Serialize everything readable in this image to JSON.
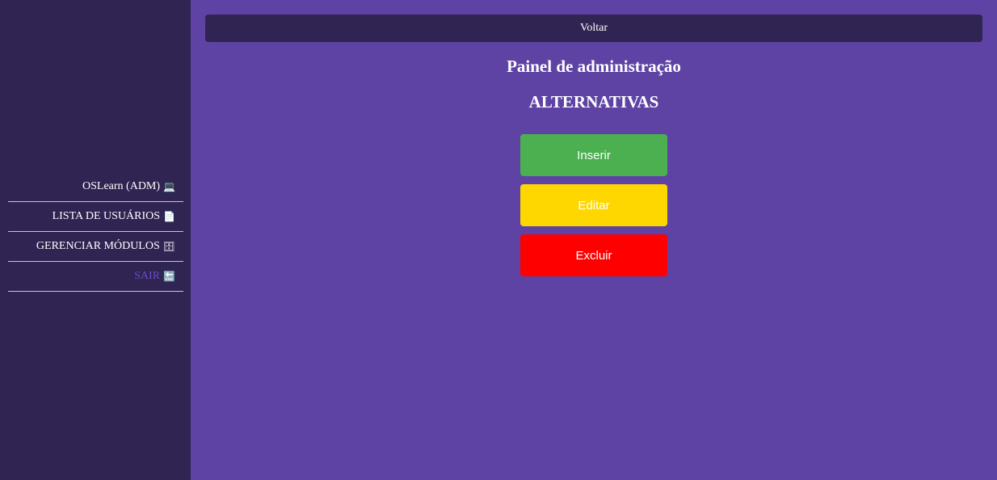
{
  "sidebar": {
    "items": [
      {
        "label": "OSLearn (ADM)",
        "emoji": "💻",
        "icon": "laptop-icon"
      },
      {
        "label": "LISTA DE USUÁRIOS",
        "emoji": "📄",
        "icon": "document-icon"
      },
      {
        "label": "GERENCIAR MÓDULOS",
        "emoji": "🗄",
        "icon": "cabinet-icon"
      },
      {
        "label": "SAIR",
        "emoji": "🔚",
        "icon": "end-icon"
      }
    ]
  },
  "header": {
    "back_label": "Voltar"
  },
  "main": {
    "title": "Painel de administração",
    "subtitle": "ALTERNATIVAS",
    "buttons": {
      "insert": "Inserir",
      "edit": "Editar",
      "delete": "Excluir"
    }
  },
  "colors": {
    "background": "#5e43a5",
    "sidebar": "#2f2452",
    "insert": "#4caf50",
    "edit": "#ffd700",
    "delete": "#ff0000",
    "active_link": "#6a4cc2"
  }
}
